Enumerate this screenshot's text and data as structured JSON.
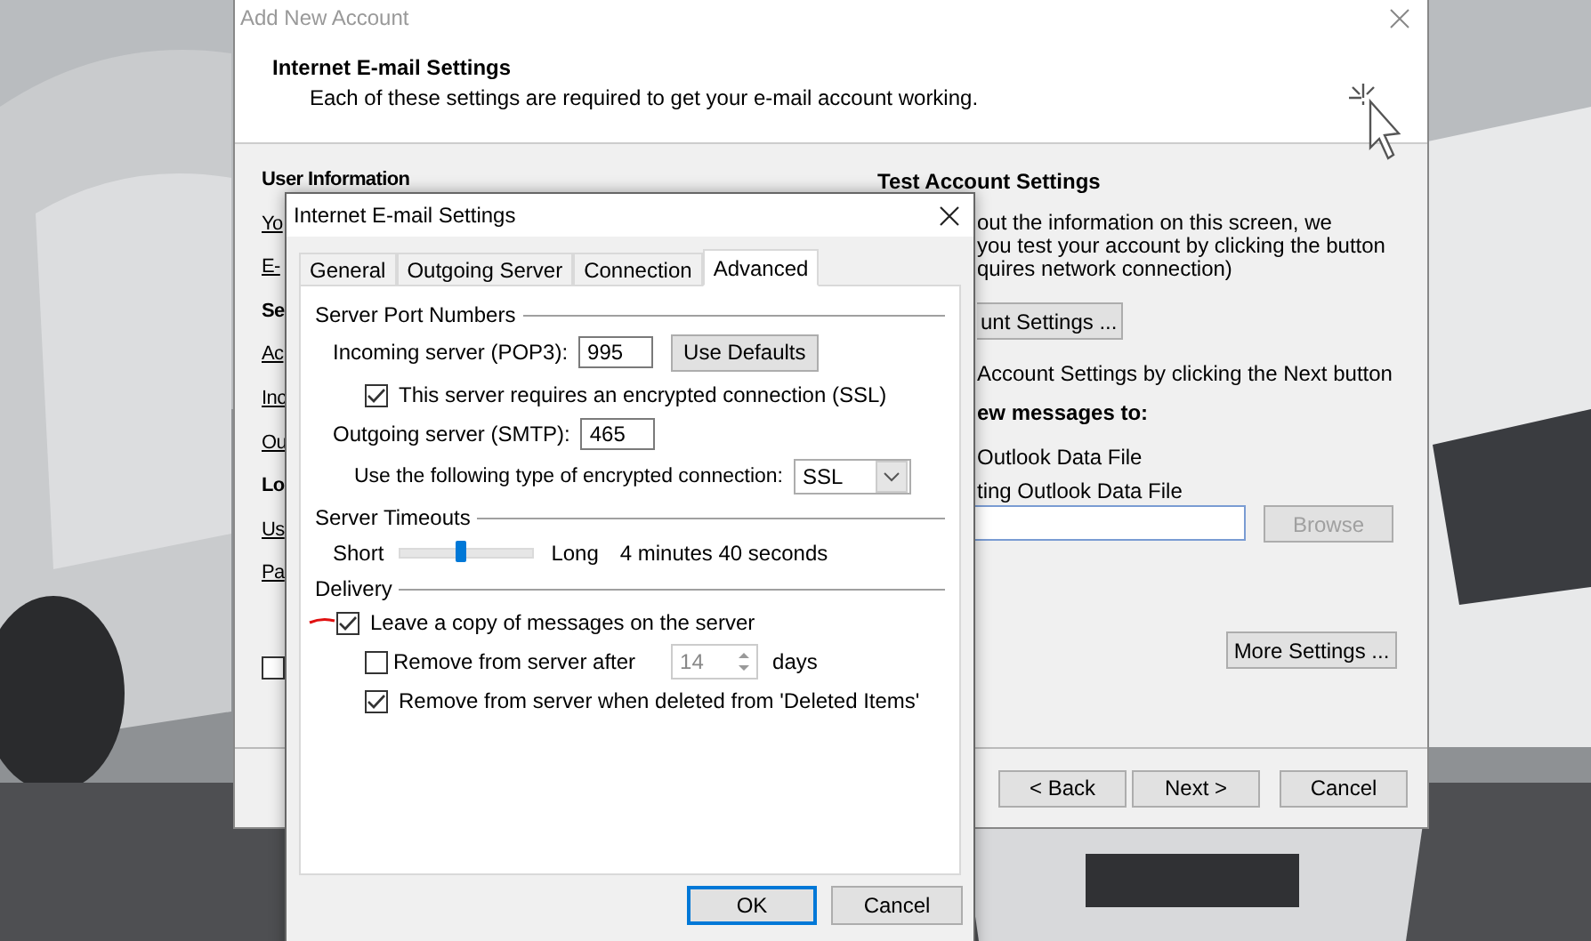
{
  "account_window": {
    "title": "Add New Account",
    "header_title": "Internet E-mail Settings",
    "header_subtitle": "Each of these settings are required to get your e-mail account working.",
    "left_labels": [
      {
        "text": "User Information",
        "kind": "heading"
      },
      {
        "text": "Yo",
        "kind": "label"
      },
      {
        "text": "E-",
        "kind": "label"
      },
      {
        "text": "Se",
        "kind": "heading"
      },
      {
        "text": "Ac",
        "kind": "label"
      },
      {
        "text": "Inc",
        "kind": "label"
      },
      {
        "text": "Ou",
        "kind": "label"
      },
      {
        "text": "Lo",
        "kind": "heading"
      },
      {
        "text": "Us",
        "kind": "label"
      },
      {
        "text": "Pa",
        "kind": "label"
      }
    ],
    "left_checkbox": {
      "checked": false
    },
    "test_heading": "Test Account Settings",
    "test_text": [
      "out the information on this screen, we",
      "you test your account by clicking the button",
      "quires network connection)"
    ],
    "test_button": "unt Settings ...",
    "next_option": "Account Settings by clicking the Next button",
    "deliver_heading": "ew messages to:",
    "deliver_options": [
      "Outlook Data File",
      "ting Outlook Data File"
    ],
    "browse_button": {
      "label": "Browse",
      "disabled": true
    },
    "more_button": "More Settings ...",
    "buttons": [
      "< Back",
      "Next >",
      "Cancel"
    ]
  },
  "dialog": {
    "title": "Internet E-mail Settings",
    "tabs": [
      {
        "label": "General",
        "selected": false
      },
      {
        "label": "Outgoing Server",
        "selected": false
      },
      {
        "label": "Connection",
        "selected": false
      },
      {
        "label": "Advanced",
        "selected": true
      }
    ],
    "port_group": "Server Port Numbers",
    "incoming_label": "Incoming server (POP3):",
    "incoming_value": "995",
    "use_defaults": "Use Defaults",
    "ssl_check": {
      "label": "This server requires an encrypted connection (SSL)",
      "checked": true
    },
    "outgoing_label": "Outgoing server (SMTP):",
    "outgoing_value": "465",
    "encryption_label": "Use the following type of encrypted connection:",
    "encryption_value": "SSL",
    "timeout_group": "Server Timeouts",
    "short": "Short",
    "long": "Long",
    "timeout": {
      "level": 0.46
    },
    "timeout_reading": "4 minutes 40 seconds",
    "delivery_group": "Delivery",
    "leave_copy": {
      "label": "Leave a copy of messages on the server",
      "checked": true
    },
    "remove_after": {
      "label": "Remove from server after",
      "checked": false
    },
    "days_value": "14",
    "days_label": "days",
    "remove_deleted": {
      "label": "Remove from server when deleted from 'Deleted Items'",
      "checked": true
    },
    "buttons": [
      {
        "label": "OK",
        "default": true
      },
      {
        "label": "Cancel",
        "default": false
      }
    ]
  }
}
